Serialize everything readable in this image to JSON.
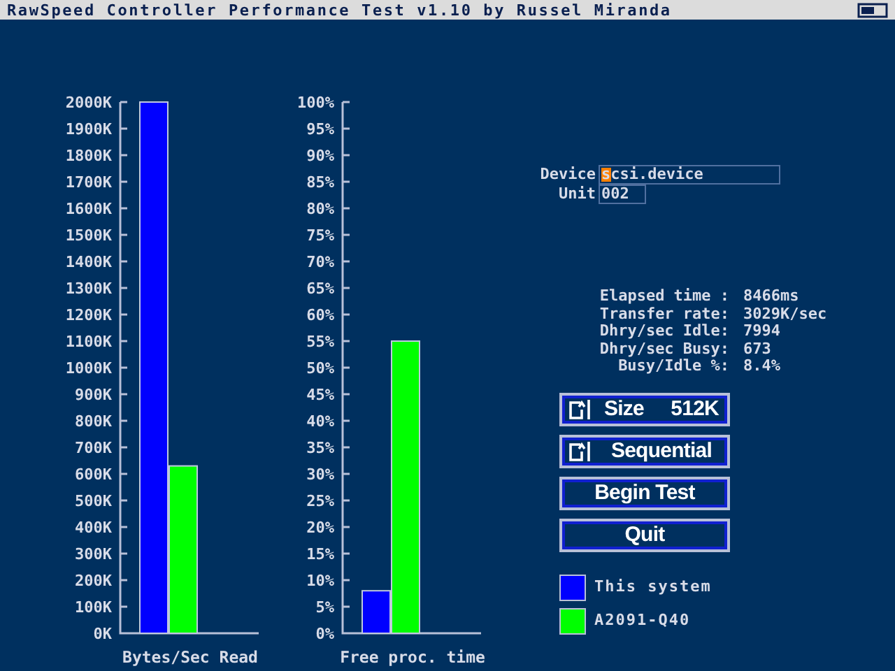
{
  "window": {
    "title": "RawSpeed Controller Performance Test v1.10 by Russel Miranda"
  },
  "charts": [
    {
      "chart_data": {
        "type": "bar",
        "xlabel": "Bytes/Sec Read",
        "ylim": [
          0,
          2000
        ],
        "yticks": [
          {
            "value": 0,
            "label": "0K"
          },
          {
            "value": 100,
            "label": "100K"
          },
          {
            "value": 200,
            "label": "200K"
          },
          {
            "value": 300,
            "label": "300K"
          },
          {
            "value": 400,
            "label": "400K"
          },
          {
            "value": 500,
            "label": "500K"
          },
          {
            "value": 600,
            "label": "600K"
          },
          {
            "value": 700,
            "label": "700K"
          },
          {
            "value": 800,
            "label": "800K"
          },
          {
            "value": 900,
            "label": "900K"
          },
          {
            "value": 1000,
            "label": "1000K"
          },
          {
            "value": 1100,
            "label": "1100K"
          },
          {
            "value": 1200,
            "label": "1200K"
          },
          {
            "value": 1300,
            "label": "1300K"
          },
          {
            "value": 1400,
            "label": "1400K"
          },
          {
            "value": 1500,
            "label": "1500K"
          },
          {
            "value": 1600,
            "label": "1600K"
          },
          {
            "value": 1700,
            "label": "1700K"
          },
          {
            "value": 1800,
            "label": "1800K"
          },
          {
            "value": 1900,
            "label": "1900K"
          },
          {
            "value": 2000,
            "label": "2000K"
          }
        ],
        "series": [
          {
            "color": "#0000ff",
            "values": [
              2000
            ]
          },
          {
            "color": "#00ff00",
            "values": [
              630
            ]
          }
        ]
      }
    },
    {
      "chart_data": {
        "type": "bar",
        "xlabel": "Free proc. time",
        "ylim": [
          0,
          100
        ],
        "yticks": [
          {
            "value": 0,
            "label": "0%"
          },
          {
            "value": 5,
            "label": "5%"
          },
          {
            "value": 10,
            "label": "10%"
          },
          {
            "value": 15,
            "label": "15%"
          },
          {
            "value": 20,
            "label": "20%"
          },
          {
            "value": 25,
            "label": "25%"
          },
          {
            "value": 30,
            "label": "30%"
          },
          {
            "value": 35,
            "label": "35%"
          },
          {
            "value": 40,
            "label": "40%"
          },
          {
            "value": 45,
            "label": "45%"
          },
          {
            "value": 50,
            "label": "50%"
          },
          {
            "value": 55,
            "label": "55%"
          },
          {
            "value": 60,
            "label": "60%"
          },
          {
            "value": 65,
            "label": "65%"
          },
          {
            "value": 70,
            "label": "70%"
          },
          {
            "value": 75,
            "label": "75%"
          },
          {
            "value": 80,
            "label": "80%"
          },
          {
            "value": 85,
            "label": "85%"
          },
          {
            "value": 90,
            "label": "90%"
          },
          {
            "value": 95,
            "label": "95%"
          },
          {
            "value": 100,
            "label": "100%"
          }
        ],
        "series": [
          {
            "color": "#0000ff",
            "values": [
              8
            ]
          },
          {
            "color": "#00ff00",
            "values": [
              55
            ]
          }
        ]
      }
    }
  ],
  "fields": [
    {
      "label": "Device",
      "value": "scsi.device"
    },
    {
      "label": "Unit",
      "value": "002"
    }
  ],
  "stats": [
    {
      "label": "Elapsed time :",
      "value": "8466ms"
    },
    {
      "label": "Transfer rate:",
      "value": "3029K/sec"
    },
    {
      "label": "Dhry/sec Idle:",
      "value": "7994"
    },
    {
      "label": "Dhry/sec Busy:",
      "value": "673"
    },
    {
      "label": "Busy/Idle %:",
      "value": "8.4%"
    }
  ],
  "buttons": [
    {
      "kind": "cycle",
      "label": "Size",
      "value": "512K"
    },
    {
      "kind": "cycle",
      "label": "Sequential"
    },
    {
      "kind": "action",
      "label": "Begin Test"
    },
    {
      "kind": "action",
      "label": "Quit"
    }
  ],
  "legend": [
    {
      "label": "This system",
      "color": "#0000ff"
    },
    {
      "label": "A2091-Q40",
      "color": "#00ff00"
    }
  ]
}
